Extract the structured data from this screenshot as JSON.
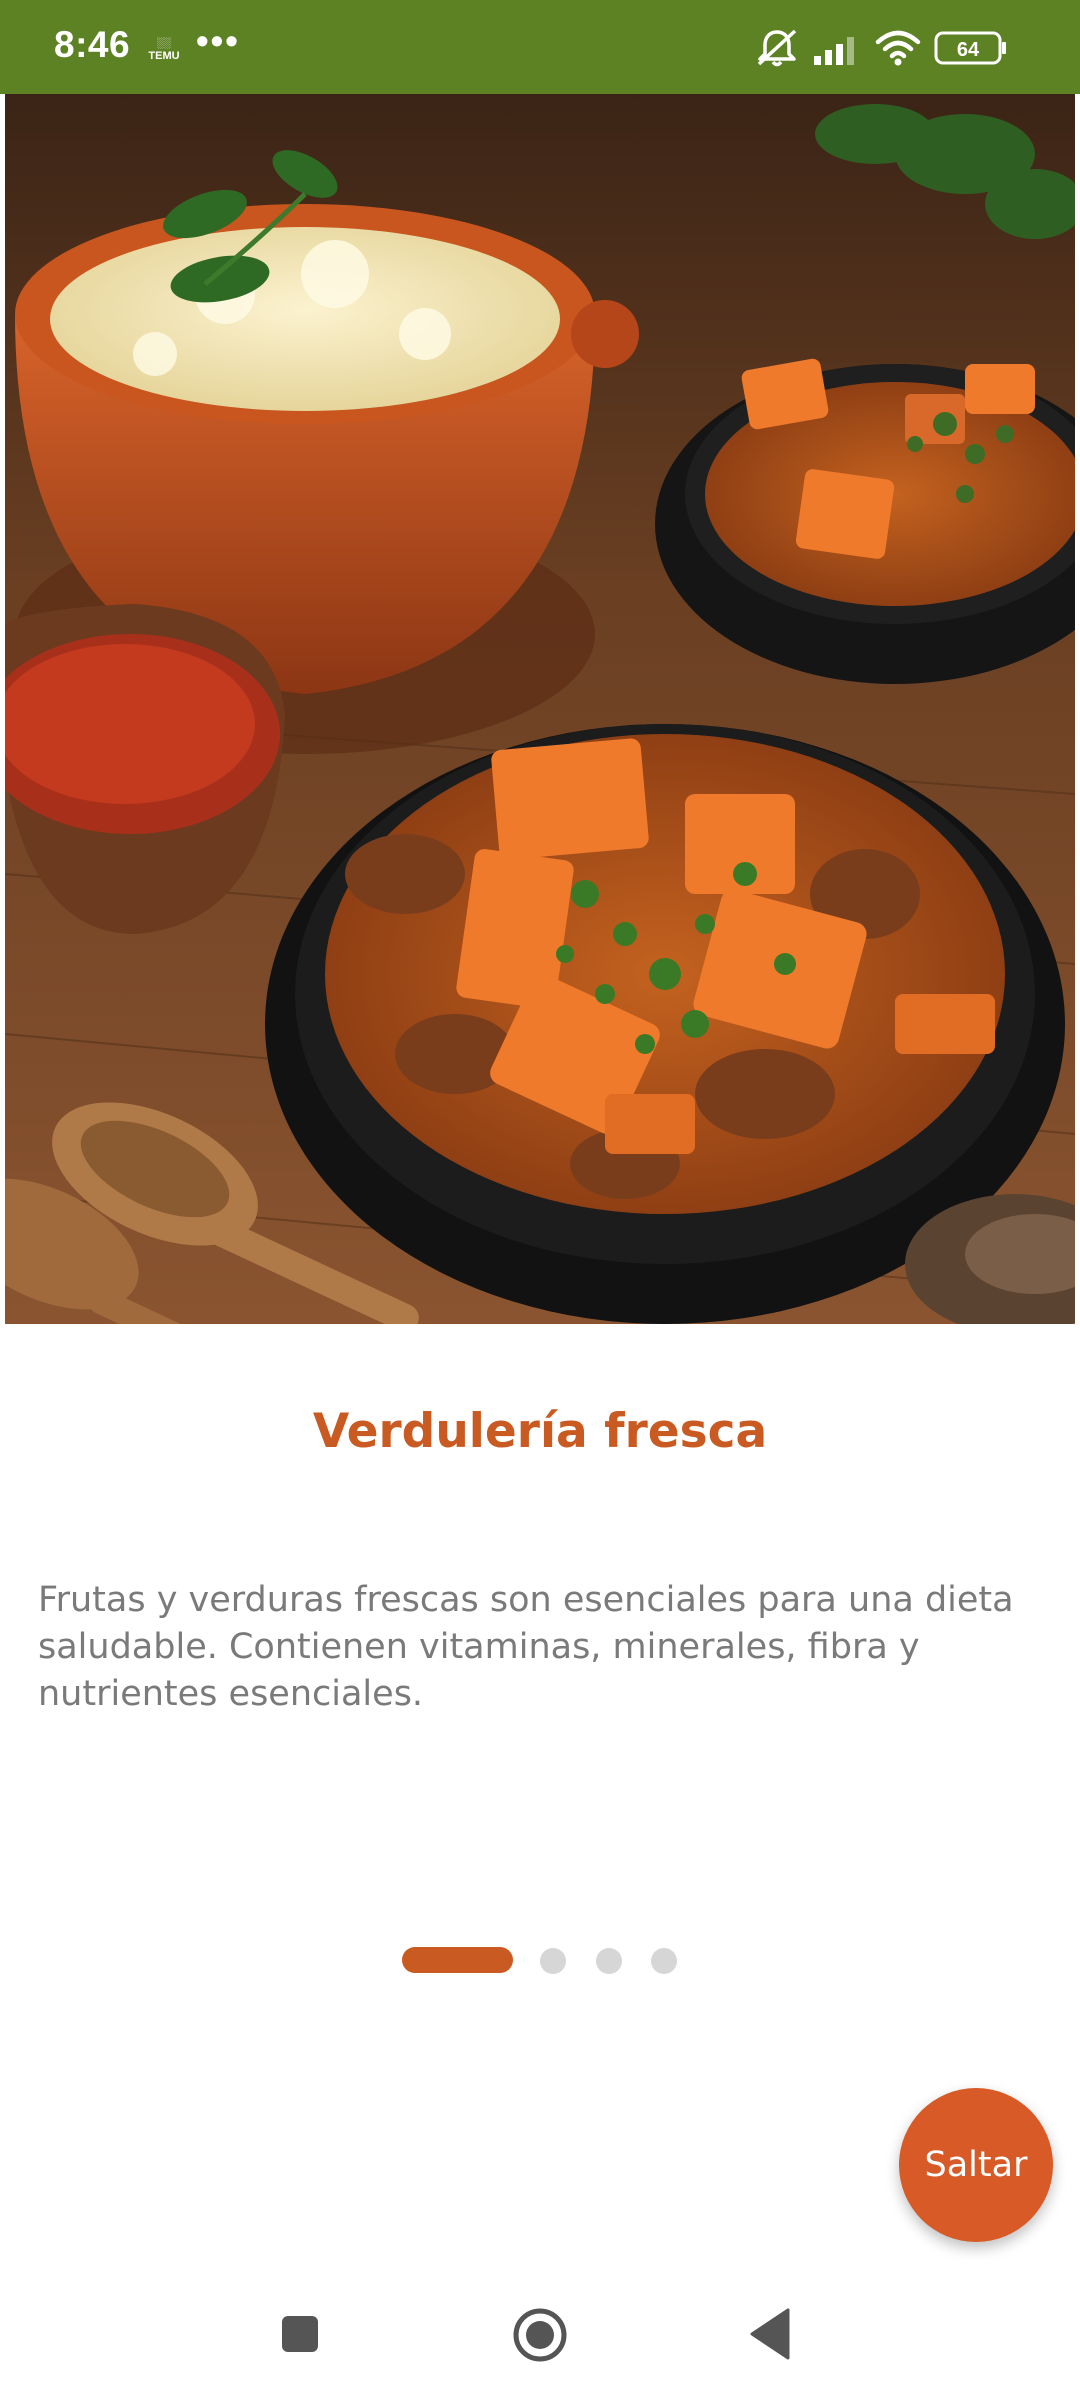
{
  "status_bar": {
    "time": "8:46",
    "temu_label": "TEMU",
    "more_indicator": "•••",
    "battery_level": "64",
    "background_color": "#5d8224"
  },
  "onboarding": {
    "title": "Verdulería fresca",
    "description": "Frutas y verduras frescas son esenciales para una dieta saludable. Contienen vitaminas, minerales, fibra y nutrientes esenciales.",
    "current_page": 1,
    "total_pages": 4,
    "accent_color": "#c95a22"
  },
  "skip_button": {
    "label": "Saltar"
  },
  "nav_bar": {
    "icons": [
      "recents-square-icon",
      "home-circle-icon",
      "back-triangle-icon"
    ]
  }
}
